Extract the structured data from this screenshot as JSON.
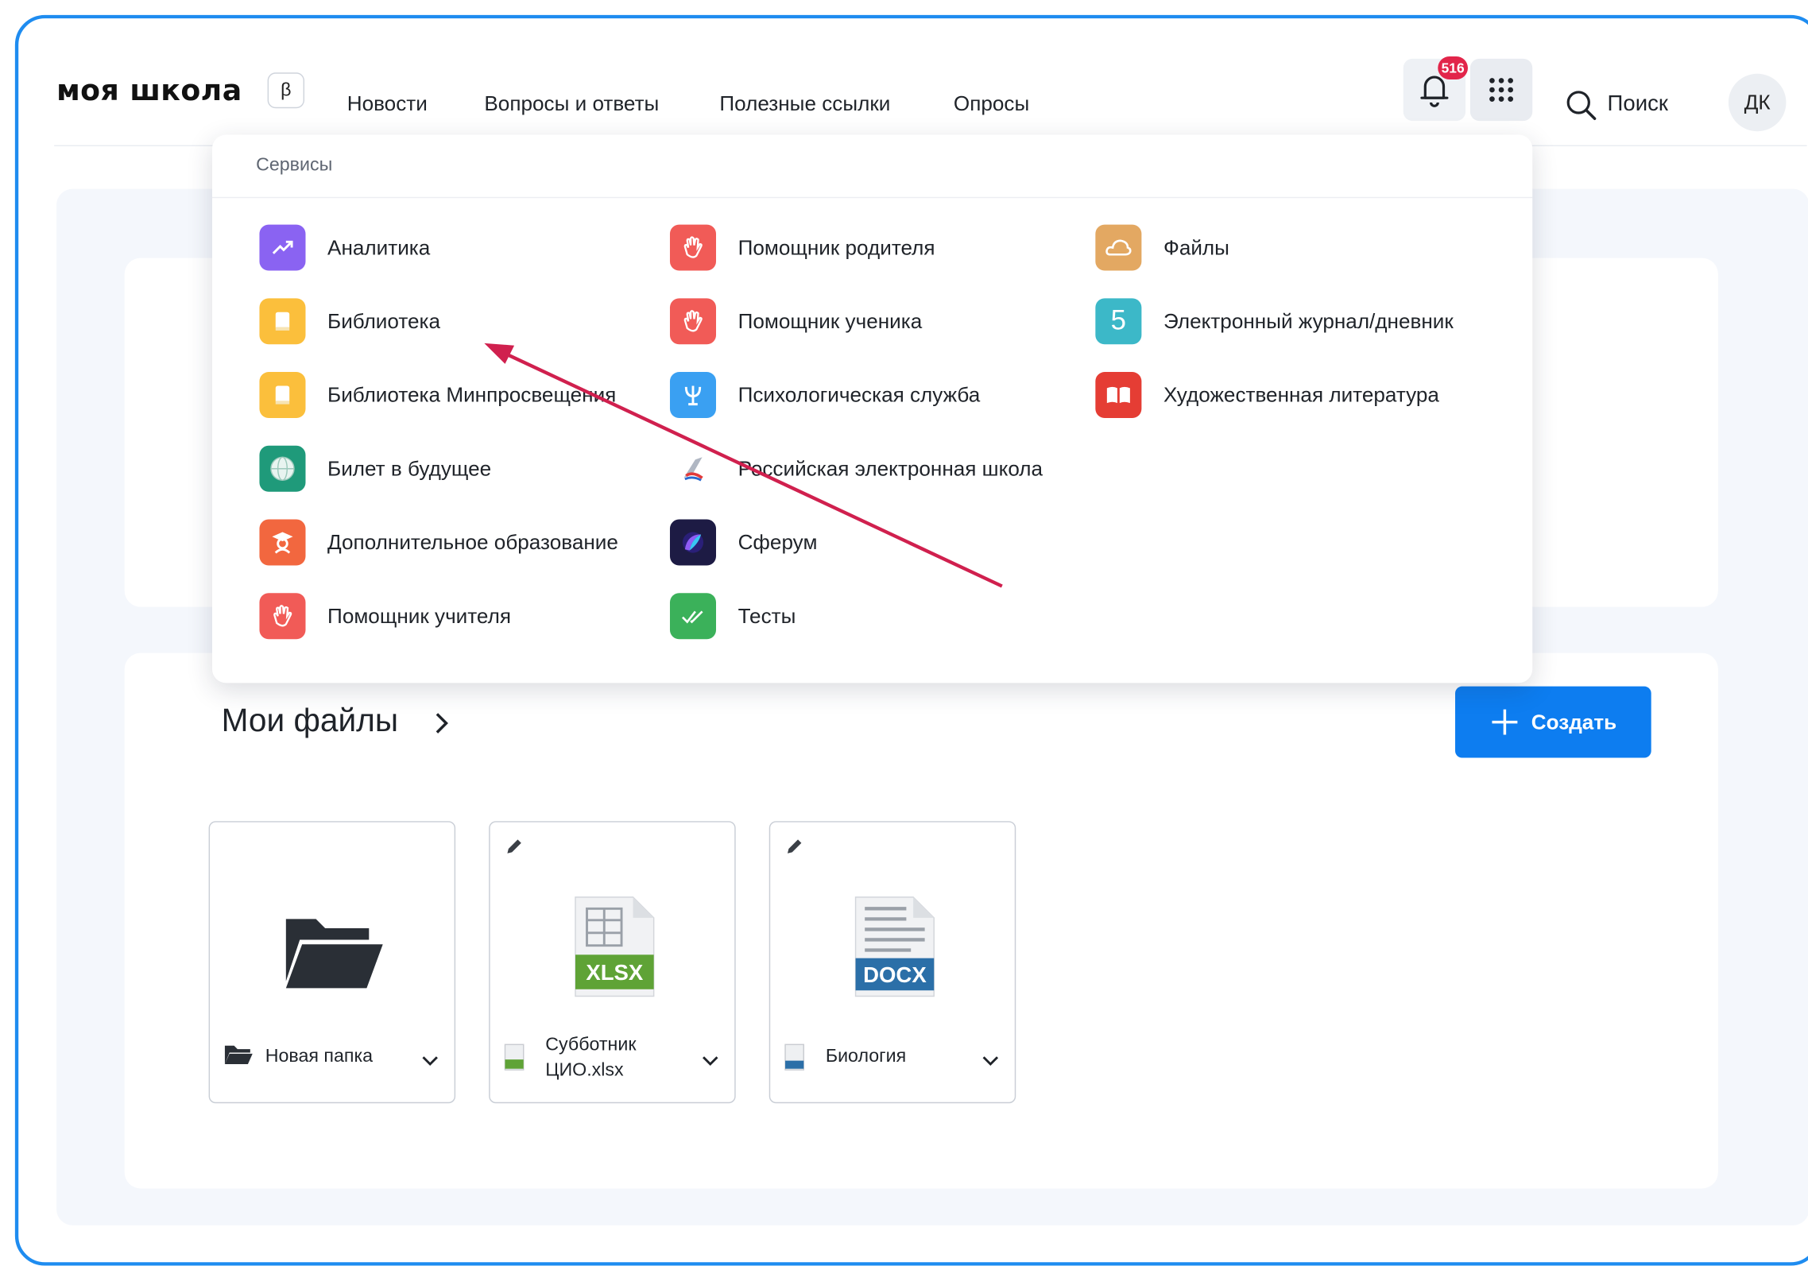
{
  "header": {
    "logo": "моя школа",
    "beta": "β",
    "nav": [
      "Новости",
      "Вопросы и ответы",
      "Полезные ссылки",
      "Опросы"
    ],
    "notifications_count": "516",
    "search_label": "Поиск",
    "avatar_initials": "ДК"
  },
  "services": {
    "title": "Сервисы",
    "col1": [
      "Аналитика",
      "Библиотека",
      "Библиотека Минпросвещения",
      "Билет в будущее",
      "Дополнительное образование",
      "Помощник учителя"
    ],
    "col2": [
      "Помощник родителя",
      "Помощник ученика",
      "Психологическая служба",
      "Российская электронная школа",
      "Сферум",
      "Тесты"
    ],
    "col3": [
      "Файлы",
      "Электронный журнал/дневник",
      "Художественная литература"
    ],
    "journal_icon_text": "5"
  },
  "files": {
    "title": "Мои файлы",
    "create_label": "Создать",
    "items": [
      {
        "name": "Новая папка"
      },
      {
        "name_line1": "Субботник",
        "name_line2": "ЦИО.xlsx",
        "badge": "XLSX"
      },
      {
        "name": "Биология",
        "badge": "DOCX"
      }
    ]
  },
  "colors": {
    "accent": "#0d7df0",
    "frame": "#1e8cf0",
    "badge": "#e2254a",
    "arrow": "#d0204e"
  }
}
